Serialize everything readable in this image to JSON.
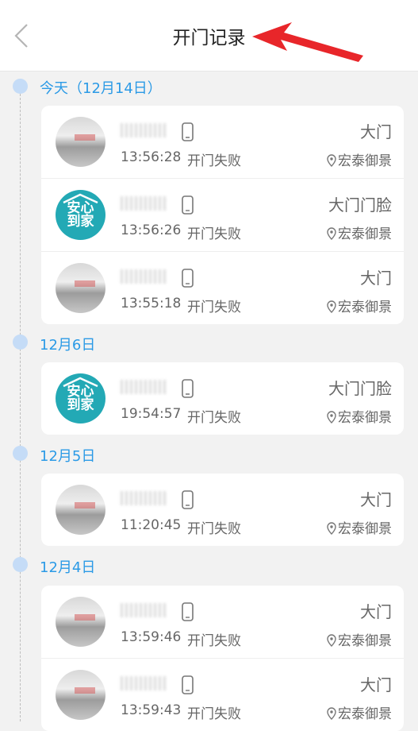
{
  "header": {
    "title": "开门记录"
  },
  "sections": [
    {
      "label": "今天（12月14日）",
      "records": [
        {
          "avatar": "photo",
          "time": "13:56:28",
          "status": "开门失败",
          "door": "大门",
          "community": "宏泰御景"
        },
        {
          "avatar": "brand",
          "time": "13:56:26",
          "status": "开门失败",
          "door": "大门门脸",
          "community": "宏泰御景"
        },
        {
          "avatar": "photo",
          "time": "13:55:18",
          "status": "开门失败",
          "door": "大门",
          "community": "宏泰御景"
        }
      ]
    },
    {
      "label": "12月6日",
      "records": [
        {
          "avatar": "brand",
          "time": "19:54:57",
          "status": "开门失败",
          "door": "大门门脸",
          "community": "宏泰御景"
        }
      ]
    },
    {
      "label": "12月5日",
      "records": [
        {
          "avatar": "photo",
          "time": "11:20:45",
          "status": "开门失败",
          "door": "大门",
          "community": "宏泰御景"
        }
      ]
    },
    {
      "label": "12月4日",
      "records": [
        {
          "avatar": "photo",
          "time": "13:59:46",
          "status": "开门失败",
          "door": "大门",
          "community": "宏泰御景"
        },
        {
          "avatar": "photo",
          "time": "13:59:43",
          "status": "开门失败",
          "door": "大门",
          "community": "宏泰御景"
        }
      ]
    }
  ],
  "brand_logo": {
    "line1": "安心",
    "line2": "到家"
  },
  "icons": {
    "back": "chevron-left-icon",
    "phone": "phone-icon",
    "location": "location-pin-icon",
    "annotation": "red-arrow-icon"
  },
  "colors": {
    "accent": "#2b9ae6",
    "dot": "#c5dcf7",
    "brand": "#23a9b5",
    "arrow": "#e8262a"
  }
}
